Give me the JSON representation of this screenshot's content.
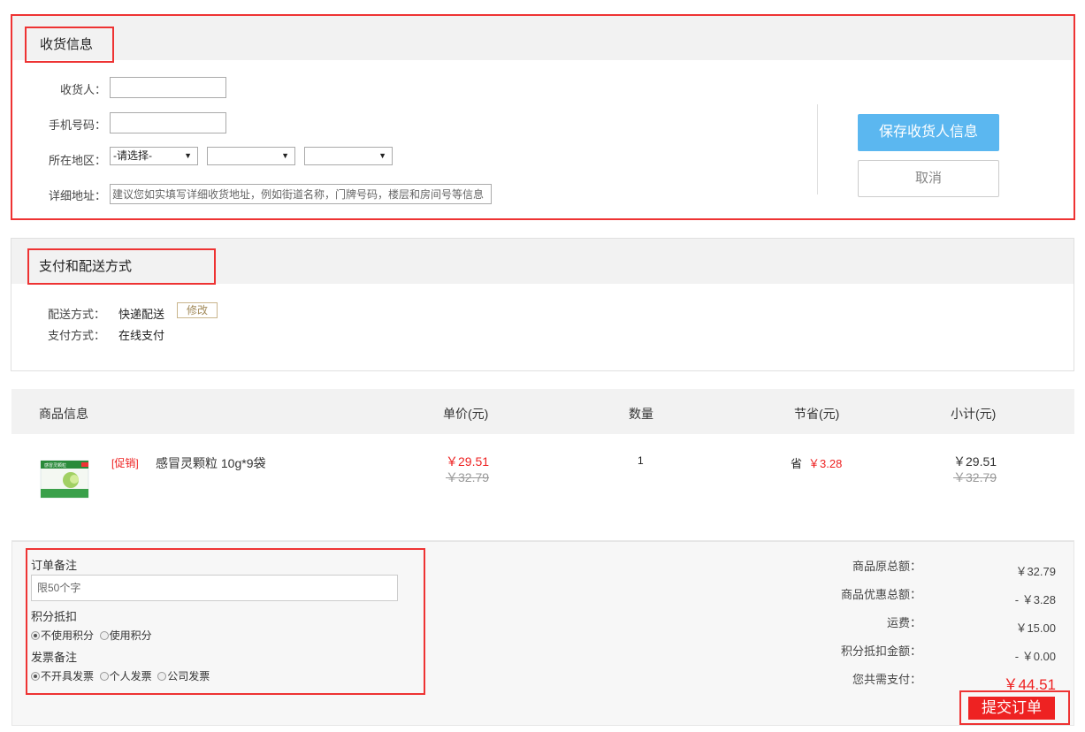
{
  "shipping": {
    "title": "收货信息",
    "receiver_label": "收货人：",
    "phone_label": "手机号码",
    "phone_colon": "：",
    "region_label": "所在地区：",
    "region_select1": "-请选择-",
    "address_label": "详细地址：",
    "address_placeholder": "建议您如实填写详细收货地址，例如街道名称，门牌号码，楼层和房间号等信息",
    "save_button": "保存收货人信息",
    "cancel_button": "取消"
  },
  "payment": {
    "title": "支付和配送方式",
    "delivery_label": "配送方式：",
    "delivery_value": "快递配送",
    "modify_button": "修改",
    "pay_label": "支付方式：",
    "pay_value": "在线支付"
  },
  "table": {
    "headers": [
      "商品信息",
      "单价(元)",
      "数量",
      "节省(元)",
      "小计(元)"
    ],
    "rows": [
      {
        "promo": "[促销]",
        "name": "感冒灵颗粒 10g*9袋",
        "image_text": "感冒灵颗粒",
        "price": "￥29.51",
        "orig_price": "￥32.79",
        "qty": "1",
        "save_prefix": "省",
        "save": "￥3.28",
        "subtotal": "￥29.51",
        "orig_subtotal": "￥32.79"
      }
    ]
  },
  "notes": {
    "remark_label": "订单备注",
    "remark_placeholder": "限50个字",
    "points_label": "积分抵扣",
    "points_opts": [
      "不使用积分",
      "使用积分"
    ],
    "invoice_label": "发票备注",
    "invoice_opts": [
      "不开具发票",
      "个人发票",
      "公司发票"
    ]
  },
  "summary": {
    "orig_total_label": "商品原总额：",
    "orig_total": "￥32.79",
    "discount_label": "商品优惠总额：",
    "discount": "- ￥3.28",
    "shipping_label": "运费：",
    "shipping": "￥15.00",
    "points_label": "积分抵扣金额：",
    "points": "- ￥0.00",
    "pay_label": "您共需支付：",
    "pay": "￥44.51",
    "submit_button": "提交订单"
  },
  "colors": {
    "accent_red": "#e22222",
    "save_blue": "#5bb7f0",
    "highlight": "#ee3333"
  }
}
